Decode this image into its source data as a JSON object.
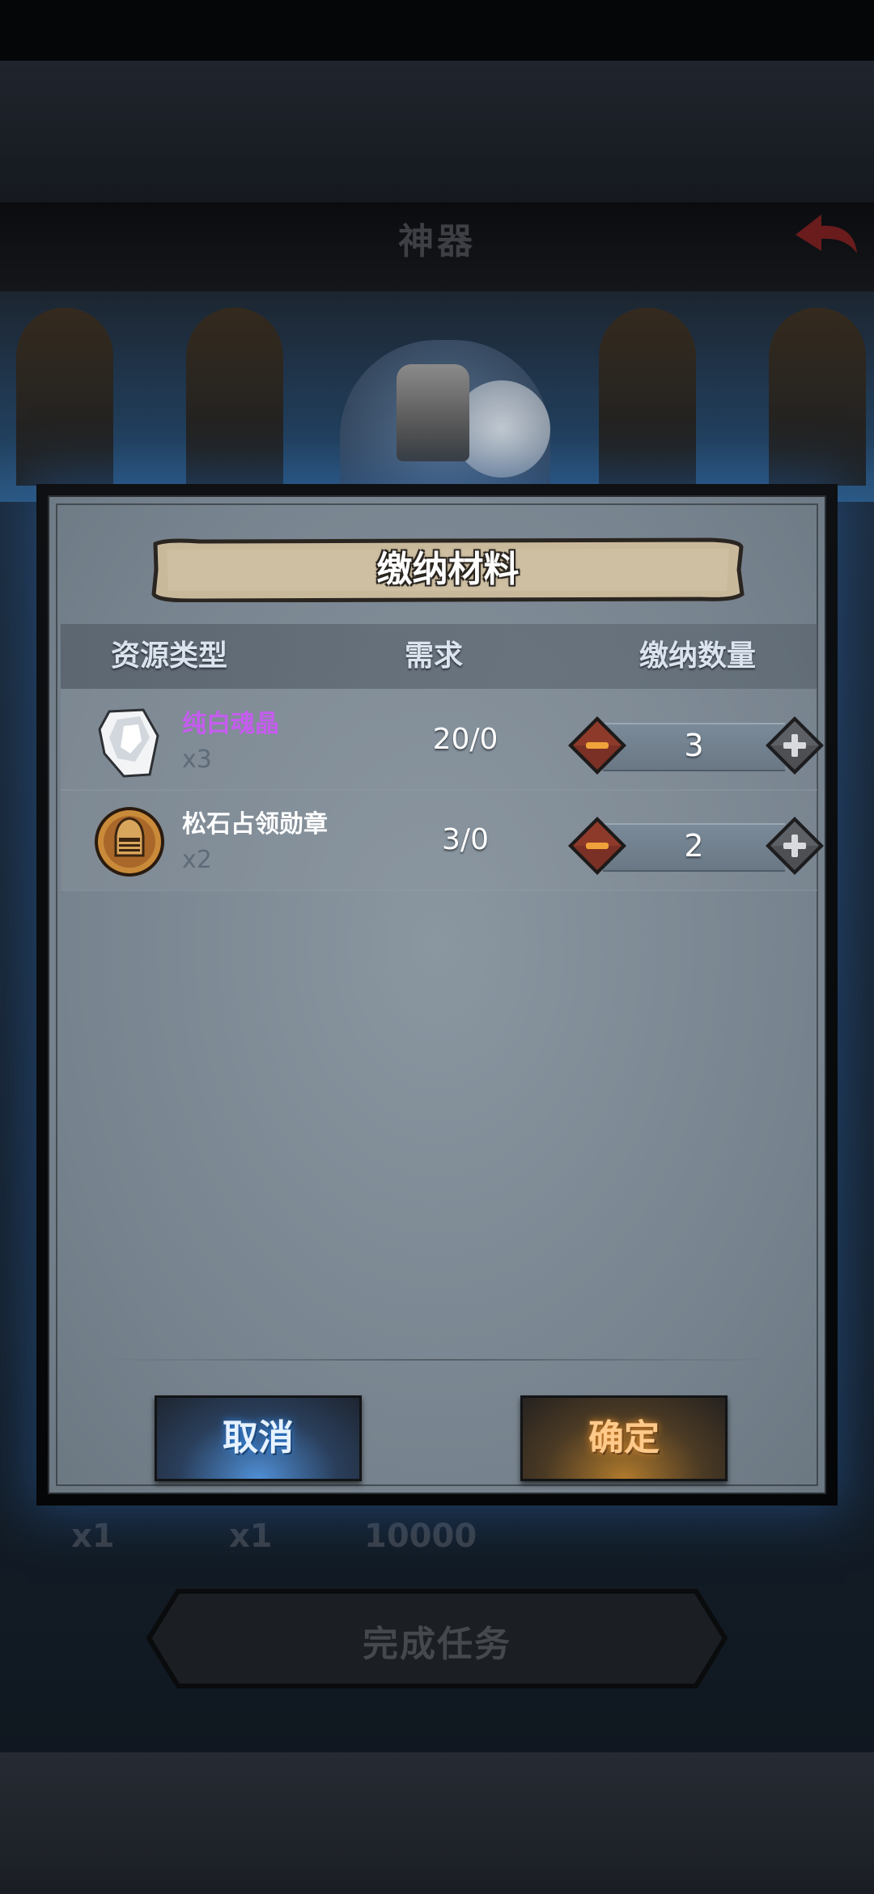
{
  "scene": {
    "title": "神器",
    "behind_labels": [
      "x1",
      "x1",
      "10000"
    ],
    "complete_button": "完成任务"
  },
  "dialog": {
    "title": "缴纳材料",
    "columns": {
      "type": "资源类型",
      "demand": "需求",
      "submit_qty": "缴纳数量"
    },
    "items": [
      {
        "name": "纯白魂晶",
        "name_color": "#c65cf0",
        "count": "x3",
        "requirement": "20/0",
        "quantity": "3",
        "icon": "white-crystal-icon"
      },
      {
        "name": "松石占领勋章",
        "name_color": "#ffffff",
        "count": "x2",
        "requirement": "3/0",
        "quantity": "2",
        "icon": "helmet-medal-icon"
      }
    ],
    "cancel_label": "取消",
    "confirm_label": "确定"
  },
  "colors": {
    "accent_blue": "#3f8ee8",
    "accent_orange": "#e08a2b",
    "rare_purple": "#c65cf0"
  }
}
